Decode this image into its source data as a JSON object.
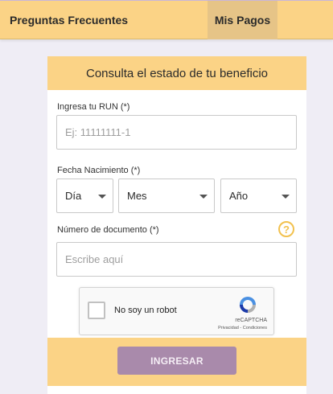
{
  "nav": {
    "faq": "Preguntas Frecuentes",
    "pagos": "Mis Pagos"
  },
  "form": {
    "title": "Consulta el estado de tu beneficio",
    "run_label": "Ingresa tu RUN (*)",
    "run_placeholder": "Ej: 11111111-1",
    "birth_label": "Fecha Nacimiento (*)",
    "day": "Día",
    "month": "Mes",
    "year": "Año",
    "doc_label": "Número de documento (*)",
    "doc_placeholder": "Escribe aquí",
    "help_symbol": "?",
    "submit": "INGRESAR"
  },
  "recaptcha": {
    "label": "No soy un robot",
    "brand": "reCAPTCHA",
    "links": "Privacidad - Condiciones"
  },
  "colors": {
    "primary_yellow": "#fbd386",
    "button_purple": "#a98aab",
    "help_yellow": "#f2c14e"
  }
}
